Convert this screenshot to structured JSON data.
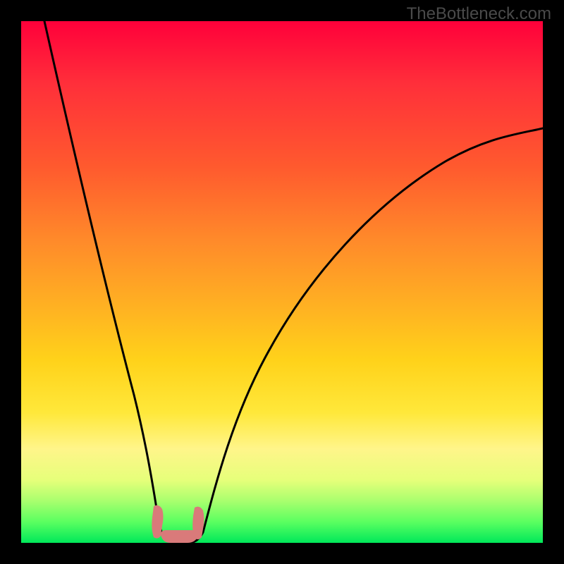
{
  "watermark": "TheBottleneck.com",
  "chart_data": {
    "type": "line",
    "title": "",
    "xlabel": "",
    "ylabel": "",
    "xlim": [
      0,
      1
    ],
    "ylim": [
      0,
      1
    ],
    "series": [
      {
        "name": "curve",
        "x": [
          0.045,
          0.1,
          0.15,
          0.2,
          0.23,
          0.255,
          0.275,
          0.295,
          0.315,
          0.335,
          0.355,
          0.4,
          0.45,
          0.52,
          0.6,
          0.7,
          0.82,
          0.92,
          1.0
        ],
        "y": [
          1.0,
          0.78,
          0.55,
          0.33,
          0.18,
          0.04,
          0.0,
          0.0,
          0.0,
          0.04,
          0.12,
          0.23,
          0.34,
          0.46,
          0.56,
          0.65,
          0.73,
          0.77,
          0.795
        ]
      }
    ],
    "markers": [
      {
        "name": "pink-blob-left",
        "x": 0.255,
        "y": 0.04
      },
      {
        "name": "pink-blob-right",
        "x": 0.335,
        "y": 0.04
      }
    ],
    "gradient_stops": [
      {
        "offset": 0.0,
        "color": "#ff003a"
      },
      {
        "offset": 0.5,
        "color": "#ffc020"
      },
      {
        "offset": 0.8,
        "color": "#fff060"
      },
      {
        "offset": 1.0,
        "color": "#00e85a"
      }
    ]
  }
}
